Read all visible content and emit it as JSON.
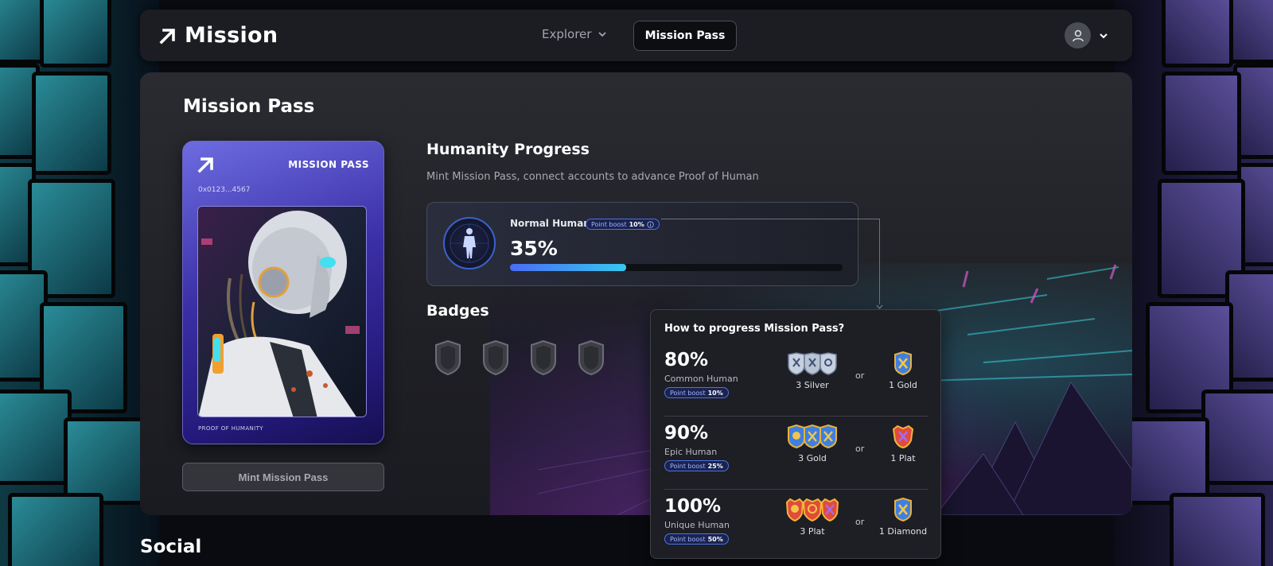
{
  "brand": {
    "name": "Mission"
  },
  "nav": {
    "explorer_label": "Explorer",
    "mission_pass_label": "Mission Pass"
  },
  "page": {
    "title": "Mission Pass"
  },
  "pass_card": {
    "title": "MISSION PASS",
    "address": "0x0123...4567",
    "footer": "PROOF OF HUMANITY",
    "mint_button": "Mint Mission Pass"
  },
  "humanity": {
    "title": "Humanity Progress",
    "description": "Mint Mission Pass, connect accounts to advance Proof of Human",
    "level_name": "Normal Human",
    "boost_label": "Point boost",
    "boost_value": "10%",
    "percent_text": "35%",
    "progress": 0.35
  },
  "badges": {
    "title": "Badges",
    "count": 4
  },
  "social": {
    "title": "Social"
  },
  "popover": {
    "title": "How to progress Mission Pass?",
    "or_label": "or",
    "tiers": [
      {
        "percent": "80%",
        "name": "Common Human",
        "boost_label": "Point boost",
        "boost_value": "10%",
        "req_a": "3 Silver",
        "req_b": "1 Gold"
      },
      {
        "percent": "90%",
        "name": "Epic Human",
        "boost_label": "Point boost",
        "boost_value": "25%",
        "req_a": "3 Gold",
        "req_b": "1 Plat"
      },
      {
        "percent": "100%",
        "name": "Unique Human",
        "boost_label": "Point boost",
        "boost_value": "50%",
        "req_a": "3 Plat",
        "req_b": "1 Diamond"
      }
    ]
  },
  "colors": {
    "accent_blue": "#4a6cf5",
    "accent_cyan": "#36c8f0",
    "card_purple": "#3b2fa6"
  },
  "icons": {
    "logo": "arrow-up-right-icon",
    "explorer_dropdown": "chevron-down-icon",
    "user": "user-icon",
    "user_dropdown": "chevron-down-icon",
    "info": "info-icon",
    "badge": "shield-badge-icon",
    "human": "human-figure-icon"
  }
}
